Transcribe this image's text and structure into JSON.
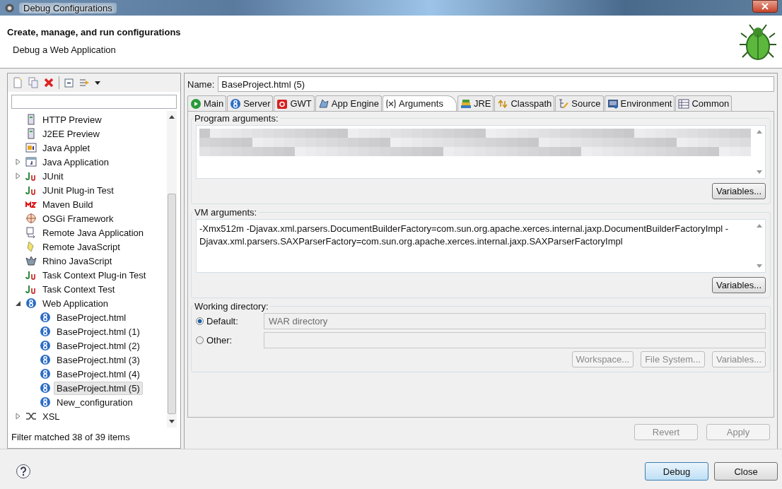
{
  "window": {
    "title": "Debug Configurations"
  },
  "header": {
    "title": "Create, manage, and run configurations",
    "subtitle": "Debug a Web Application"
  },
  "tree": [
    {
      "label": "HTTP Preview",
      "has_children": false,
      "selected": false
    },
    {
      "label": "J2EE Preview",
      "has_children": false,
      "selected": false
    },
    {
      "label": "Java Applet",
      "has_children": false,
      "selected": false
    },
    {
      "label": "Java Application",
      "has_children": true,
      "expanded": false,
      "selected": false
    },
    {
      "label": "JUnit",
      "has_children": true,
      "expanded": false,
      "selected": false
    },
    {
      "label": "JUnit Plug-in Test",
      "has_children": false,
      "selected": false
    },
    {
      "label": "Maven Build",
      "has_children": false,
      "selected": false
    },
    {
      "label": "OSGi Framework",
      "has_children": false,
      "selected": false
    },
    {
      "label": "Remote Java Application",
      "has_children": false,
      "selected": false
    },
    {
      "label": "Remote JavaScript",
      "has_children": false,
      "selected": false
    },
    {
      "label": "Rhino JavaScript",
      "has_children": false,
      "selected": false
    },
    {
      "label": "Task Context Plug-in Test",
      "has_children": false,
      "selected": false
    },
    {
      "label": "Task Context Test",
      "has_children": false,
      "selected": false
    },
    {
      "label": "Web Application",
      "has_children": true,
      "expanded": true,
      "selected": false,
      "children": [
        {
          "label": "BaseProject.html",
          "selected": false
        },
        {
          "label": "BaseProject.html (1)",
          "selected": false
        },
        {
          "label": "BaseProject.html (2)",
          "selected": false
        },
        {
          "label": "BaseProject.html (3)",
          "selected": false
        },
        {
          "label": "BaseProject.html (4)",
          "selected": false
        },
        {
          "label": "BaseProject.html (5)",
          "selected": true
        },
        {
          "label": "New_configuration",
          "selected": false
        }
      ]
    },
    {
      "label": "XSL",
      "has_children": true,
      "expanded": false,
      "selected": false
    }
  ],
  "filter_status": "Filter matched 38 of 39 items",
  "name": {
    "label": "Name:",
    "value": "BaseProject.html (5)"
  },
  "tabs": [
    {
      "label": "Main",
      "selected": false
    },
    {
      "label": "Server",
      "selected": false
    },
    {
      "label": "GWT",
      "selected": false
    },
    {
      "label": "App Engine",
      "selected": false
    },
    {
      "label": "Arguments",
      "selected": true
    },
    {
      "label": "JRE",
      "selected": false
    },
    {
      "label": "Classpath",
      "selected": false
    },
    {
      "label": "Source",
      "selected": false
    },
    {
      "label": "Environment",
      "selected": false
    },
    {
      "label": "Common",
      "selected": false
    }
  ],
  "program_arguments": {
    "label": "Program arguments:",
    "button": "Variables..."
  },
  "vm_arguments": {
    "label": "VM arguments:",
    "value": "-Xmx512m -Djavax.xml.parsers.DocumentBuilderFactory=com.sun.org.apache.xerces.internal.jaxp.DocumentBuilderFactoryImpl -Djavax.xml.parsers.SAXParserFactory=com.sun.org.apache.xerces.internal.jaxp.SAXParserFactoryImpl",
    "button": "Variables..."
  },
  "working_directory": {
    "label": "Working directory:",
    "options": [
      {
        "label": "Default:",
        "selected": true,
        "value": "WAR directory"
      },
      {
        "label": "Other:",
        "selected": false
      }
    ],
    "buttons": [
      {
        "label": "Workspace...",
        "disabled": true
      },
      {
        "label": "File System...",
        "disabled": true
      },
      {
        "label": "Variables...",
        "disabled": true
      }
    ]
  },
  "actions": [
    {
      "label": "Revert",
      "disabled": true
    },
    {
      "label": "Apply",
      "disabled": true
    }
  ],
  "footer_buttons": [
    {
      "label": "Debug",
      "default": true
    },
    {
      "label": "Close",
      "default": false
    }
  ]
}
